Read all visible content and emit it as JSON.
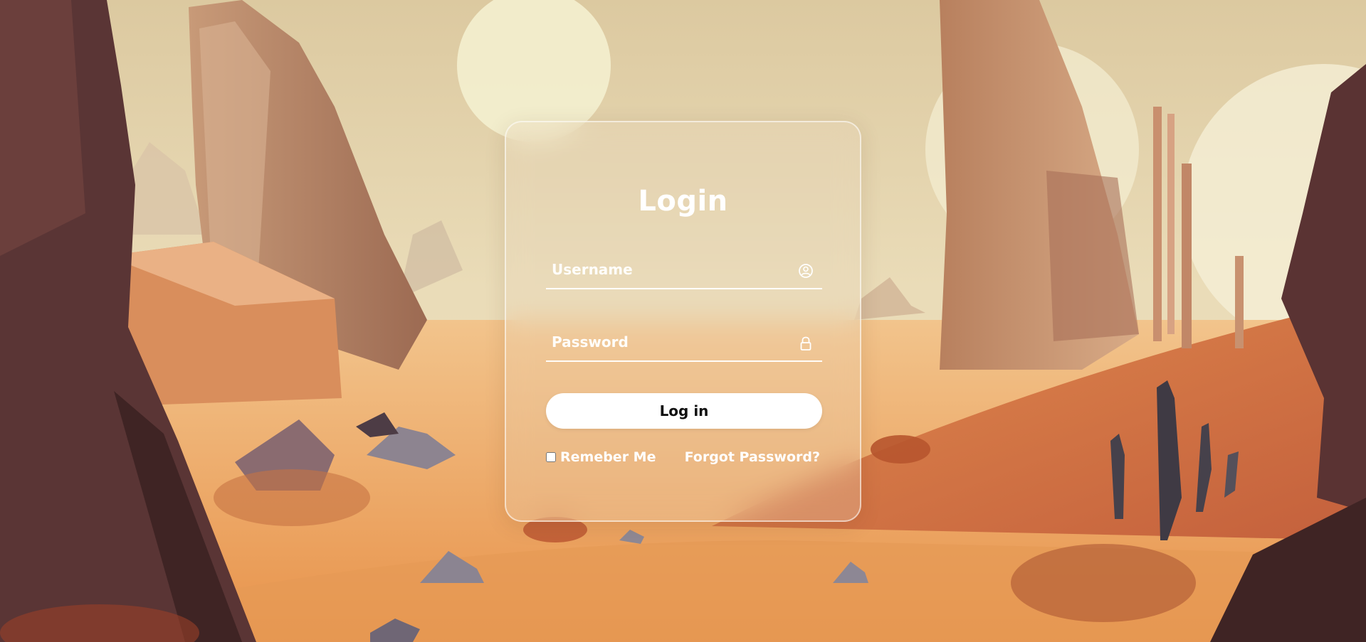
{
  "form": {
    "title": "Login",
    "username": {
      "placeholder": "Username",
      "value": "",
      "icon": "user-circle-icon"
    },
    "password": {
      "placeholder": "Password",
      "value": "",
      "icon": "lock-icon"
    },
    "login_label": "Log in",
    "remember_label": "Remeber Me",
    "remember_checked": false,
    "forgot_label": "Forgot Password?"
  },
  "theme": {
    "sky": "#e8d9b4",
    "sand": "#f0a45c",
    "rock": "#b98767",
    "dark_rock": "#4a2c2c",
    "text": "#ffffff",
    "button_bg": "#ffffff",
    "button_text": "#111111"
  }
}
